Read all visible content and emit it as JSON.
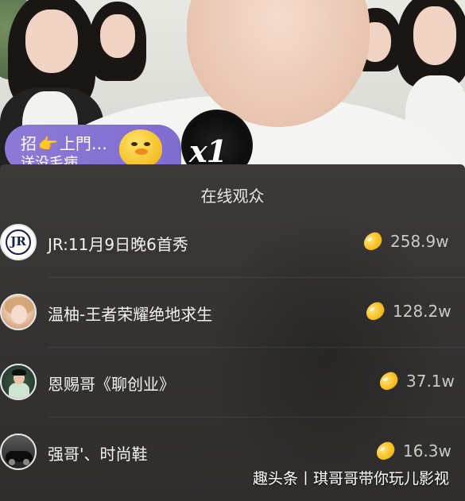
{
  "live": {
    "gift_banner": {
      "line1_prefix": "招",
      "line1_suffix": "上門…",
      "line2": "送没毛病"
    },
    "gift_multiplier": "x1"
  },
  "audience_panel": {
    "title": "在线观众",
    "coin_icon": "gold-bean-icon",
    "viewers": [
      {
        "name": "JR:11月9日晚6首秀",
        "score": "258.9w",
        "avatar": "JR"
      },
      {
        "name": "温柚-王者荣耀绝地求生",
        "score": "128.2w",
        "avatar": ""
      },
      {
        "name": "恩赐哥《聊创业》",
        "score": "37.1w",
        "avatar": ""
      },
      {
        "name": "强哥'、时尚鞋",
        "score": "16.3w",
        "avatar": ""
      }
    ]
  },
  "watermark": "趣头条丨琪哥哥带你玩儿影视"
}
